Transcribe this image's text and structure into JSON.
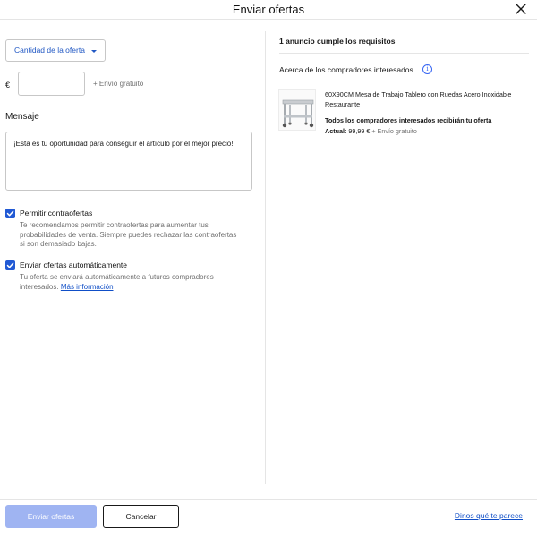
{
  "header": {
    "title": "Enviar ofertas"
  },
  "offer": {
    "dropdown_label": "Cantidad de la oferta",
    "currency": "€",
    "price_value": "",
    "shipping_label": "+ Envío gratuito"
  },
  "message": {
    "label": "Mensaje",
    "value": "¡Esta es tu oportunidad para conseguir el artículo por el mejor precio!"
  },
  "options": {
    "counteroffers": {
      "checked": true,
      "label": "Permitir contraofertas",
      "help": "Te recomendamos permitir contraofertas para aumentar tus probabilidades de venta. Siempre puedes rechazar las contraofertas si son demasiado bajas."
    },
    "auto_offers": {
      "checked": true,
      "label": "Enviar ofertas automáticamente",
      "help": "Tu oferta se enviará automáticamente a futuros compradores interesados.",
      "link": "Más información"
    }
  },
  "right_panel": {
    "requirements": "1 anuncio cumple los requisitos",
    "about_buyers": "Acerca de los compradores interesados",
    "info_icon": "info-icon",
    "listing": {
      "title": "60X90CM Mesa de Trabajo Tablero con Ruedas Acero Inoxidable Restaurante",
      "note": "Todos los compradores interesados recibirán tu oferta",
      "price_label": "Actual:",
      "price": "99,99 €",
      "shipping": "+ Envío gratuito"
    }
  },
  "footer": {
    "send_button": "Enviar ofertas",
    "cancel_button": "Cancelar",
    "feedback_link": "Dinos qué te parece"
  },
  "colors": {
    "accent": "#3665f3",
    "link": "#0f4ec7",
    "checkbox": "#2159d4",
    "send_disabled": "#9fb4f2"
  }
}
